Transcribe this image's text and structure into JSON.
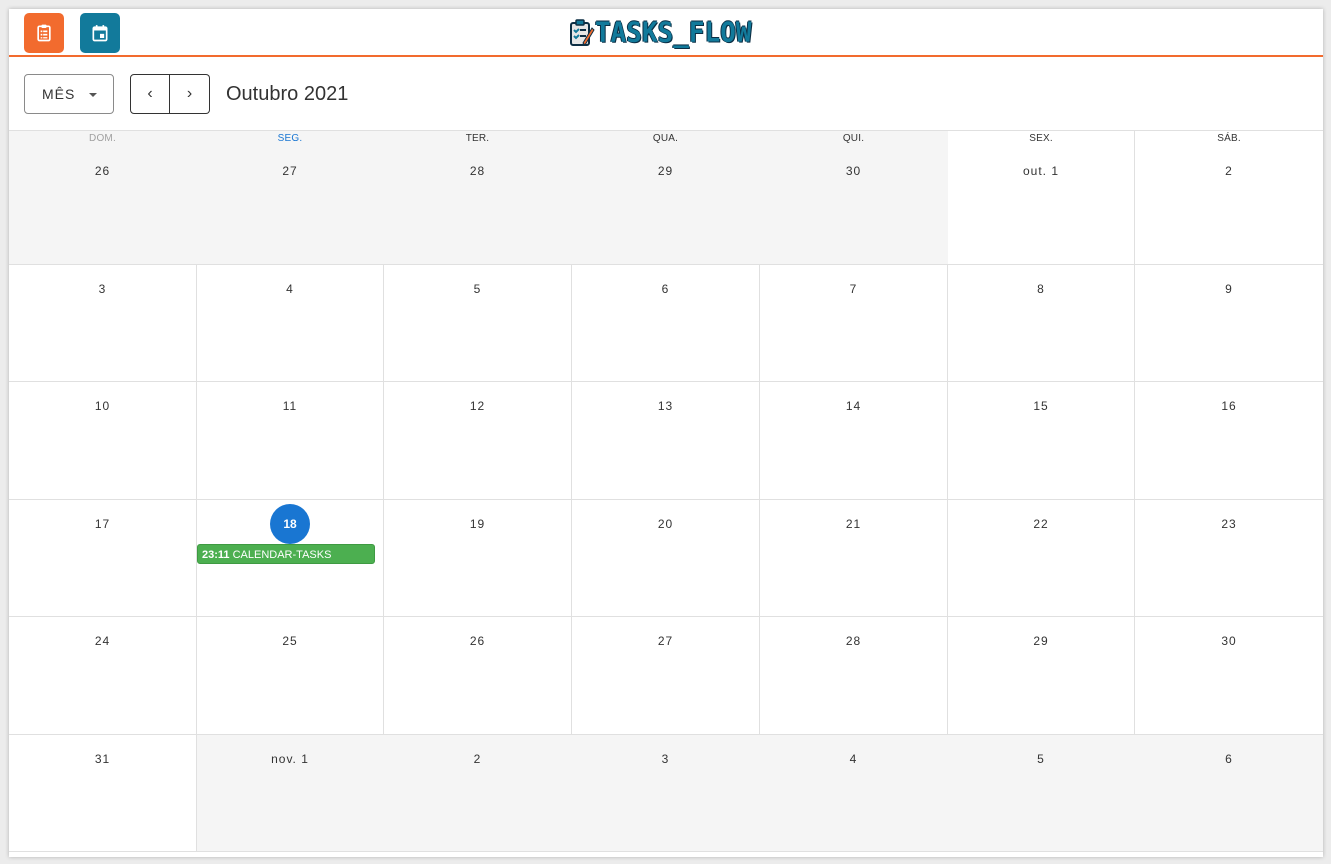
{
  "header": {
    "tasks_icon": "clipboard-list-icon",
    "calendar_icon": "calendar-icon",
    "logo_text": "TASKS_FLOW",
    "colors": {
      "accent_orange": "#f26b2e",
      "accent_teal": "#127a9b",
      "today_blue": "#1976d2",
      "event_green": "#4caf50"
    }
  },
  "toolbar": {
    "view_label": "MÊS",
    "prev_label": "‹",
    "next_label": "›",
    "month_title": "Outubro 2021"
  },
  "calendar": {
    "weekdays": [
      "DOM.",
      "SEG.",
      "TER.",
      "QUA.",
      "QUI.",
      "SEX.",
      "SÁB."
    ],
    "weeks": [
      [
        "26",
        "27",
        "28",
        "29",
        "30",
        "out. 1",
        "2"
      ],
      [
        "3",
        "4",
        "5",
        "6",
        "7",
        "8",
        "9"
      ],
      [
        "10",
        "11",
        "12",
        "13",
        "14",
        "15",
        "16"
      ],
      [
        "17",
        "18",
        "19",
        "20",
        "21",
        "22",
        "23"
      ],
      [
        "24",
        "25",
        "26",
        "27",
        "28",
        "29",
        "30"
      ],
      [
        "31",
        "nov. 1",
        "2",
        "3",
        "4",
        "5",
        "6"
      ]
    ],
    "today": "18",
    "event": {
      "time": "23:11",
      "title": "CALENDAR-TASKS"
    }
  }
}
